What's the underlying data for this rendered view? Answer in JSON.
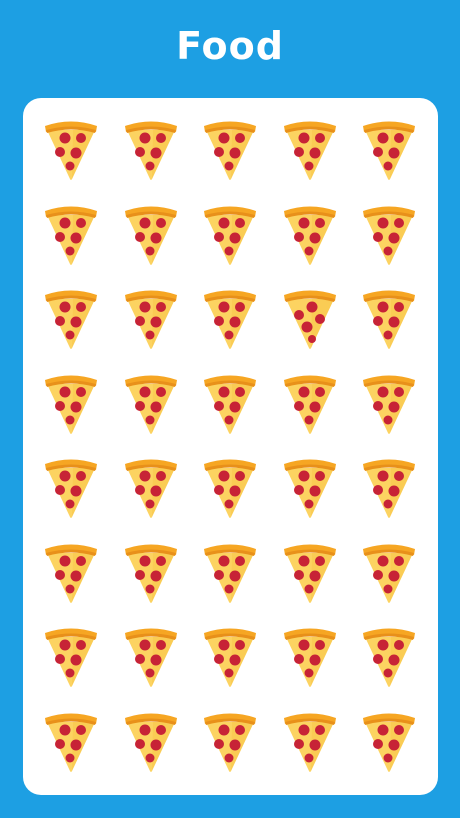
{
  "title": "Food",
  "board": {
    "rows": 8,
    "cols": 5,
    "item": "pizza-slice-icon",
    "odd_one_out": {
      "row": 2,
      "col": 3
    }
  },
  "colors": {
    "background": "#1d9fe3",
    "board": "#ffffff",
    "crust": "#f6a623",
    "crust_dark": "#e8901a",
    "cheese": "#fcd361",
    "pepperoni": "#c72336"
  }
}
